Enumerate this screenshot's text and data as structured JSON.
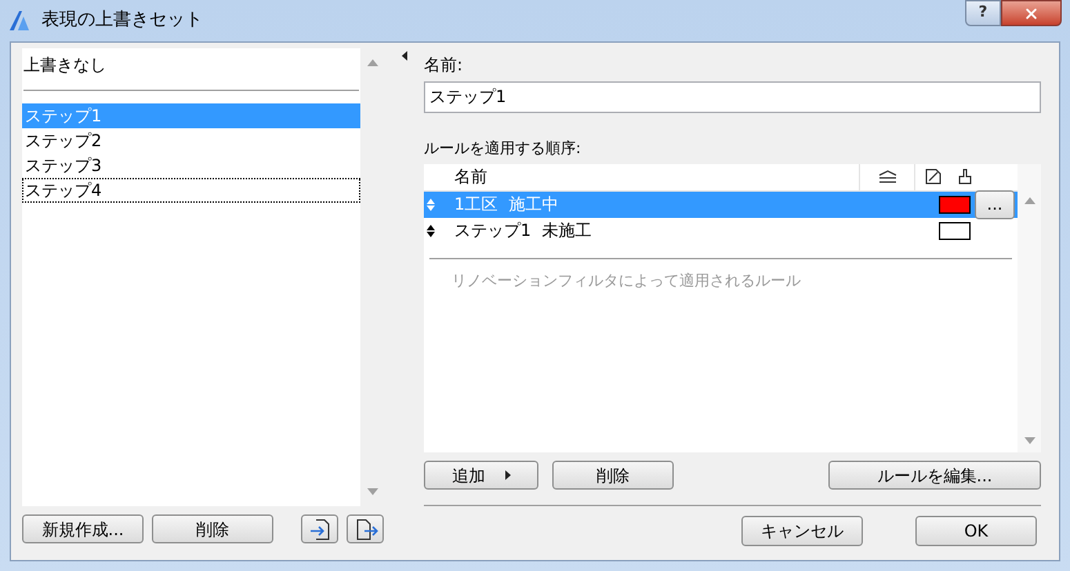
{
  "window": {
    "title": "表現の上書きセット",
    "help": "?"
  },
  "sets": {
    "none_item": {
      "label": "上書きなし",
      "selected": false
    },
    "items": [
      {
        "label": "ステップ1",
        "selected": true,
        "focused": false
      },
      {
        "label": "ステップ2",
        "selected": false,
        "focused": false
      },
      {
        "label": "ステップ3",
        "selected": false,
        "focused": false
      },
      {
        "label": "ステップ4",
        "selected": false,
        "focused": true
      }
    ],
    "buttons": [
      "新規作成...",
      "削除"
    ]
  },
  "name_field": {
    "label": "名前:",
    "value": "ステップ1"
  },
  "rules": {
    "label": "ルールを適用する順序:",
    "columns": [
      "名前"
    ],
    "rows": [
      {
        "name": "1工区  施工中",
        "color": "#ff0000",
        "selected": true
      },
      {
        "name": "ステップ1  未施工",
        "color": "#ffffff",
        "selected": false
      }
    ],
    "more_button": "...",
    "renovation_label": "リノベーションフィルタによって適用されるルール",
    "buttons": {
      "add": "追加",
      "delete": "削除",
      "edit": "ルールを編集..."
    }
  },
  "footer": {
    "cancel": "キャンセル",
    "ok": "OK"
  }
}
